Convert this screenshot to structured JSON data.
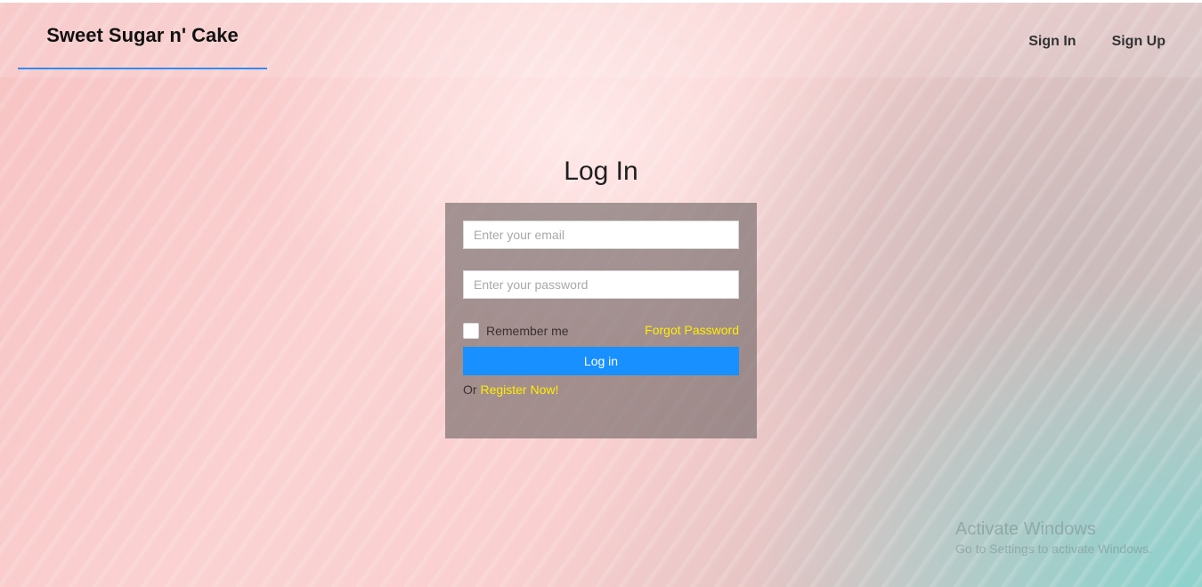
{
  "header": {
    "brand": "Sweet Sugar n' Cake",
    "nav": {
      "sign_in": "Sign In",
      "sign_up": "Sign Up"
    }
  },
  "login": {
    "title": "Log In",
    "email_placeholder": "Enter your email",
    "password_placeholder": "Enter your password",
    "remember_label": "Remember me",
    "forgot_label": "Forgot Password",
    "login_button": "Log in",
    "register_prefix": "Or ",
    "register_link": "Register Now!"
  },
  "watermark": {
    "title": "Activate Windows",
    "subtitle": "Go to Settings to activate Windows."
  },
  "colors": {
    "accent": "#1890ff",
    "link_yellow": "#ffee00",
    "brand_underline": "#2f8bf0"
  }
}
